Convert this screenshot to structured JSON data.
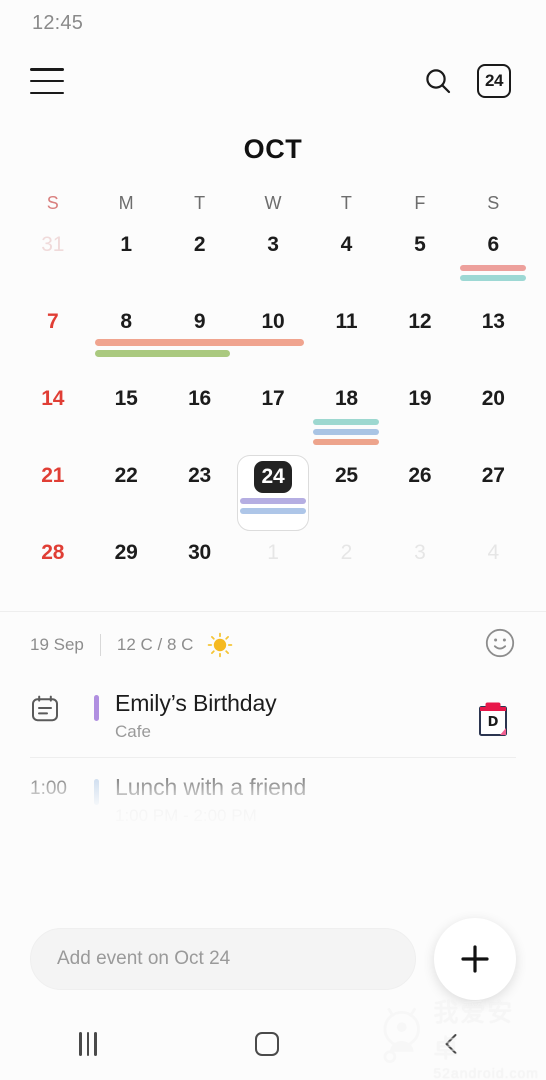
{
  "status": {
    "time": "12:45"
  },
  "appbar": {
    "menu_icon": "hamburger-menu-icon",
    "search_icon": "search-icon",
    "today_label": "24"
  },
  "month": {
    "title": "OCT"
  },
  "weekdays": [
    "S",
    "M",
    "T",
    "W",
    "T",
    "F",
    "S"
  ],
  "weeks": [
    {
      "days": [
        {
          "n": "31",
          "type": "out"
        },
        {
          "n": "1",
          "type": "normal"
        },
        {
          "n": "2",
          "type": "normal"
        },
        {
          "n": "3",
          "type": "normal"
        },
        {
          "n": "4",
          "type": "normal"
        },
        {
          "n": "5",
          "type": "normal"
        },
        {
          "n": "6",
          "type": "normal",
          "bars": [
            "#eda09c",
            "#9dd8d4"
          ]
        }
      ]
    },
    {
      "days": [
        {
          "n": "7",
          "type": "sunday"
        },
        {
          "n": "8",
          "type": "normal"
        },
        {
          "n": "9",
          "type": "normal"
        },
        {
          "n": "10",
          "type": "normal"
        },
        {
          "n": "11",
          "type": "normal"
        },
        {
          "n": "12",
          "type": "normal"
        },
        {
          "n": "13",
          "type": "normal"
        }
      ],
      "spans": [
        {
          "color": "#f0a48f",
          "start": 1,
          "end": 3,
          "row": 0
        },
        {
          "color": "#aac97f",
          "start": 1,
          "end": 2,
          "row": 1
        }
      ]
    },
    {
      "days": [
        {
          "n": "14",
          "type": "sunday"
        },
        {
          "n": "15",
          "type": "normal"
        },
        {
          "n": "16",
          "type": "normal"
        },
        {
          "n": "17",
          "type": "normal"
        },
        {
          "n": "18",
          "type": "normal",
          "bars": [
            "#9dd8d0",
            "#a9c4e4",
            "#eda48c"
          ]
        },
        {
          "n": "19",
          "type": "normal"
        },
        {
          "n": "20",
          "type": "normal"
        }
      ]
    },
    {
      "days": [
        {
          "n": "21",
          "type": "sunday"
        },
        {
          "n": "22",
          "type": "normal"
        },
        {
          "n": "23",
          "type": "normal"
        },
        {
          "n": "24",
          "type": "selected",
          "bars": [
            "#b5aee2",
            "#aec6e8"
          ]
        },
        {
          "n": "25",
          "type": "normal"
        },
        {
          "n": "26",
          "type": "normal"
        },
        {
          "n": "27",
          "type": "normal"
        }
      ]
    },
    {
      "days": [
        {
          "n": "28",
          "type": "sunday"
        },
        {
          "n": "29",
          "type": "normal"
        },
        {
          "n": "30",
          "type": "normal"
        },
        {
          "n": "1",
          "type": "next"
        },
        {
          "n": "2",
          "type": "next"
        },
        {
          "n": "3",
          "type": "next"
        },
        {
          "n": "4",
          "type": "next"
        }
      ]
    }
  ],
  "weather": {
    "date": "19 Sep",
    "temps": "12 C / 8 C",
    "condition_icon": "sun-icon",
    "mood_icon": "smiley-face-icon"
  },
  "events": [
    {
      "lead_icon": "calendar-icon",
      "time": "",
      "color": "#b08fe0",
      "title": "Emily’s Birthday",
      "subtitle": "Cafe",
      "trail_icon": "clipboard-sticker-icon",
      "trail_letter": "D"
    },
    {
      "lead_icon": "",
      "time": "1:00",
      "color": "#a9c4e4",
      "title": "Lunch with a friend",
      "subtitle": "1:00 PM - 2:00 PM",
      "trail_icon": "",
      "trail_letter": ""
    }
  ],
  "compose": {
    "placeholder": "Add event on Oct 24",
    "fab_icon": "plus-icon"
  },
  "navbar": {
    "recents_icon": "recents-icon",
    "home_icon": "home-icon",
    "back_icon": "back-icon"
  },
  "watermark": {
    "cn": "我爱安卓",
    "en": "52android.com"
  },
  "colors": {
    "accent_selected": "#232323",
    "sunday": "#e03e35",
    "sun_yellow": "#f5b920"
  }
}
